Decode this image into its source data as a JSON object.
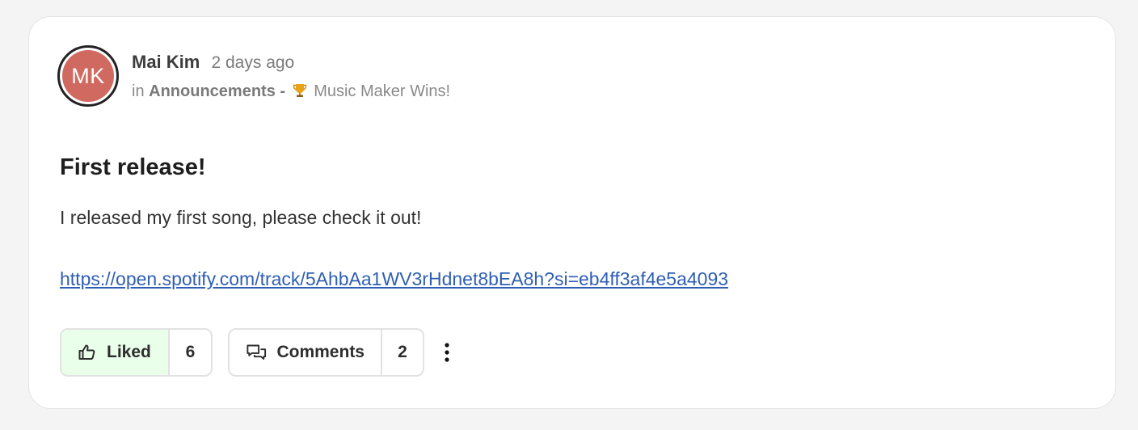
{
  "post": {
    "author": {
      "initials": "MK",
      "name": "Mai Kim",
      "avatar_color": "#d06a60"
    },
    "time": "2 days ago",
    "context": {
      "prefix": "in",
      "space": "Announcements",
      "separator": "-",
      "topic_icon": "trophy-icon",
      "topic": "Music Maker Wins!"
    },
    "title": "First release!",
    "body": "I released my first song, please check it out!",
    "link": "https://open.spotify.com/track/5AhbAa1WV3rHdnet8bEA8h?si=eb4ff3af4e5a4093",
    "actions": {
      "like_label": "Liked",
      "like_icon": "thumbs-up-icon",
      "like_count": "6",
      "like_active_bg": "#eaffea",
      "comments_label": "Comments",
      "comments_icon": "speech-bubbles-icon",
      "comments_count": "2",
      "more_icon": "vertical-ellipsis-icon"
    }
  }
}
